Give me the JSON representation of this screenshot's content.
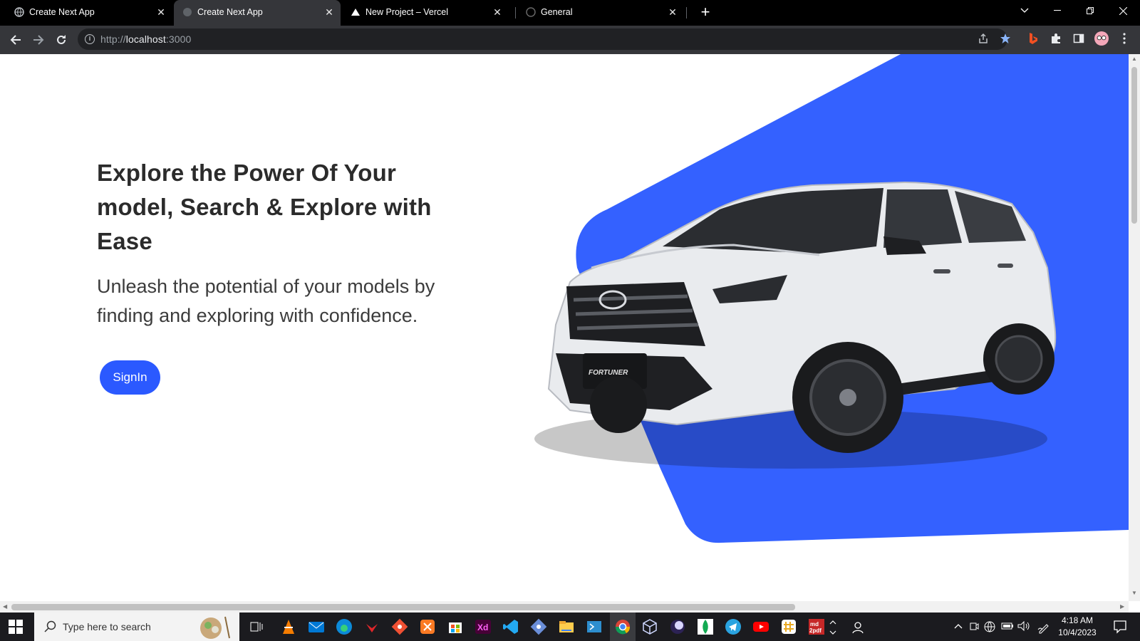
{
  "browser": {
    "tabs": [
      {
        "title": "Create Next App",
        "favicon": "globe-icon",
        "active": false
      },
      {
        "title": "Create Next App",
        "favicon": "globe-icon",
        "active": true
      },
      {
        "title": "New Project – Vercel",
        "favicon": "vercel-triangle-icon",
        "active": false
      },
      {
        "title": "General",
        "favicon": "github-icon",
        "active": false
      }
    ],
    "url_scheme": "http://",
    "url_host": "localhost",
    "url_port": ":3000"
  },
  "hero": {
    "title": "Explore the Power Of Your model, Search & Explore with Ease",
    "subtitle": "Unleash the potential of your models by finding and exploring with confidence.",
    "signin_label": "SignIn",
    "accent_color": "#2b59ff"
  },
  "taskbar": {
    "search_placeholder": "Type here to search",
    "time": "4:18 AM",
    "date": "10/4/2023",
    "apps": [
      "task-view-icon",
      "vlc-icon",
      "mail-icon",
      "edge-icon",
      "huawei-icon",
      "git-icon",
      "xampp-icon",
      "store-icon",
      "adobe-xd-icon",
      "vscode-icon",
      "sourcetree-icon",
      "file-explorer-icon",
      "powershell-icon",
      "chrome-icon",
      "virtualbox-icon",
      "eclipse-icon",
      "mongodb-icon",
      "telegram-icon",
      "youtube-icon",
      "slack-icon",
      "md2pdf-icon"
    ]
  }
}
